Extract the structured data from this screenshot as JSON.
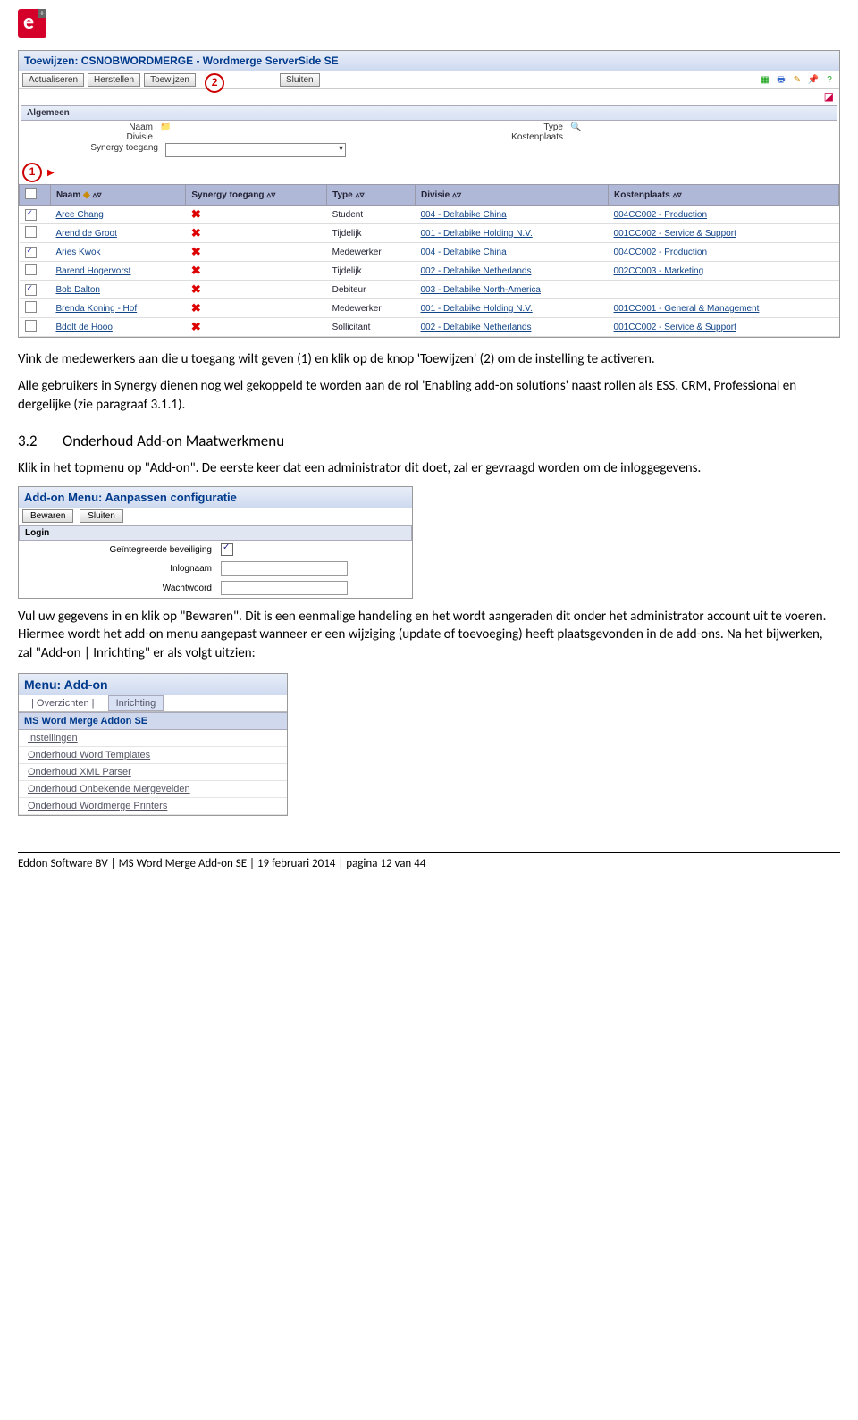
{
  "logo_alt": "e+",
  "shot1": {
    "title": "Toewijzen: CSNOBWORDMERGE - Wordmerge ServerSide SE",
    "buttons": [
      "Actualiseren",
      "Herstellen",
      "Toewijzen",
      "Sluiten"
    ],
    "section_general": "Algemeen",
    "form": {
      "naam": "Naam",
      "type": "Type",
      "divisie": "Divisie",
      "kosten": "Kostenplaats",
      "syntoe": "Synergy toegang"
    },
    "cols": [
      "",
      "Naam",
      "Synergy toegang",
      "Type",
      "Divisie",
      "Kostenplaats"
    ],
    "rows": [
      {
        "chk": true,
        "naam": "Aree Chang",
        "type": "Student",
        "div": "004 - Deltabike China",
        "kp": "004CC002 - Production"
      },
      {
        "chk": false,
        "naam": "Arend de Groot",
        "type": "Tijdelijk",
        "div": "001 - Deltabike Holding N.V.",
        "kp": "001CC002 - Service & Support"
      },
      {
        "chk": true,
        "naam": "Aries Kwok",
        "type": "Medewerker",
        "div": "004 - Deltabike China",
        "kp": "004CC002 - Production"
      },
      {
        "chk": false,
        "naam": "Barend Hogervorst",
        "type": "Tijdelijk",
        "div": "002 - Deltabike Netherlands",
        "kp": "002CC003 - Marketing"
      },
      {
        "chk": true,
        "naam": "Bob Dalton",
        "type": "Debiteur",
        "div": "003 - Deltabike North-America",
        "kp": ""
      },
      {
        "chk": false,
        "naam": "Brenda Koning - Hof",
        "type": "Medewerker",
        "div": "001 - Deltabike Holding N.V.",
        "kp": "001CC001 - General & Management"
      },
      {
        "chk": false,
        "naam": "Bdolt de Hooo",
        "type": "Sollicitant",
        "div": "002 - Deltabike Netherlands",
        "kp": "001CC002 - Service & Support"
      }
    ]
  },
  "para1": "Vink de medewerkers aan die u toegang wilt geven (1) en klik op de knop 'Toewijzen' (2) om de instelling te activeren.",
  "para2": "Alle gebruikers in Synergy dienen nog wel gekoppeld te worden aan de rol 'Enabling add-on solutions' naast rollen als ESS, CRM, Professional en dergelijke (zie paragraaf 3.1.1).",
  "heading": {
    "num": "3.2",
    "text": "Onderhoud Add-on Maatwerkmenu"
  },
  "para3": "Klik in het topmenu op \"Add-on\". De eerste keer dat een administrator dit doet, zal er gevraagd worden om de inloggegevens.",
  "shot2": {
    "title": "Add-on Menu: Aanpassen configuratie",
    "buttons": [
      "Bewaren",
      "Sluiten"
    ],
    "section": "Login",
    "rows": [
      {
        "label": "Geïntegreerde beveiliging",
        "type": "check",
        "checked": true
      },
      {
        "label": "Inlognaam",
        "type": "text"
      },
      {
        "label": "Wachtwoord",
        "type": "text"
      }
    ]
  },
  "para4": "Vul uw gegevens in en klik op \"Bewaren\". Dit is een eenmalige handeling en het wordt aangeraden dit onder het administrator account uit te voeren. Hiermee wordt het add-on menu aangepast wanneer er een wijziging (update of toevoeging) heeft plaatsgevonden in de add-ons. Na het bijwerken, zal \"Add-on | Inrichting\" er als volgt uitzien:",
  "shot3": {
    "title": "Menu: Add-on",
    "tabs": [
      "| Overzichten |",
      "Inrichting"
    ],
    "group": "MS Word Merge Addon SE",
    "items": [
      "Instellingen",
      "Onderhoud Word Templates",
      "Onderhoud XML Parser",
      "Onderhoud Onbekende Mergevelden",
      "Onderhoud Wordmerge Printers"
    ]
  },
  "footer": "Eddon Software BV | MS Word Merge Add-on SE | 19 februari 2014 | pagina 12 van 44"
}
